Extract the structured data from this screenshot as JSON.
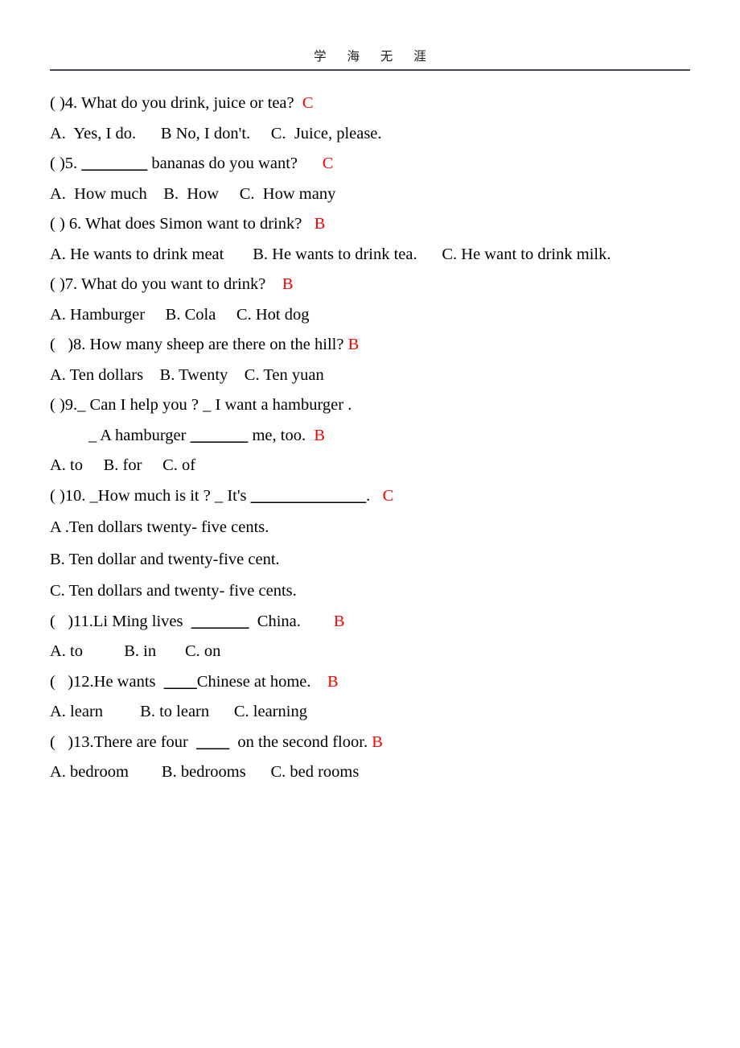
{
  "header": {
    "watermark_title": "学 海 无 涯"
  },
  "document": {
    "blocks": [
      {
        "type": "question",
        "number": "4",
        "prefix": "( )4. ",
        "text": "What do you drink, juice or tea?",
        "gap": "  ",
        "answer": "C"
      },
      {
        "type": "options",
        "text": "A.  Yes, I do.      B No, I don't.     C.  Juice, please."
      },
      {
        "type": "question_blank",
        "number": "5",
        "prefix": "( )5. ",
        "blank": "________",
        "text_after": " bananas do you want?",
        "gap": "      ",
        "answer": "C"
      },
      {
        "type": "options",
        "text": "A.  How much    B.  How     C.  How many"
      },
      {
        "type": "question",
        "number": "6",
        "prefix": "( ) 6. ",
        "text": "What does Simon want to drink?",
        "gap": "   ",
        "answer": "B"
      },
      {
        "type": "options",
        "text": "A. He wants to drink meat       B. He wants to drink tea.      C. He want to drink milk."
      },
      {
        "type": "question",
        "number": "7",
        "prefix": "( )7. ",
        "text": "What do you want to drink?",
        "gap": "    ",
        "answer": "B"
      },
      {
        "type": "options",
        "text": "A. Hamburger     B. Cola     C. Hot dog"
      },
      {
        "type": "question",
        "number": "8",
        "prefix": "(   )8. ",
        "text": "How many sheep are there on the hill?",
        "gap": " ",
        "answer": "B"
      },
      {
        "type": "options",
        "text": "A. Ten dollars    B. Twenty    C. Ten yuan"
      },
      {
        "type": "question",
        "number": "9",
        "prefix": "( )9.",
        "text": "_ Can I help you ? _ I want a hamburger .",
        "gap": "",
        "answer": ""
      },
      {
        "type": "continuation_blank",
        "text_before": "_ A hamburger ",
        "blank": "_______",
        "text_after": " me, too.",
        "gap": "  ",
        "answer": "B"
      },
      {
        "type": "options",
        "text": "A. to     B. for     C. of"
      },
      {
        "type": "question_blank",
        "number": "10",
        "prefix": "( )10. _How much is it ? _ It's ",
        "blank": "______________",
        "text_after": ".",
        "gap": "   ",
        "answer": "C"
      },
      {
        "type": "options_stacked",
        "text": "A .Ten dollars twenty- five cents."
      },
      {
        "type": "options_stacked",
        "text": "B. Ten dollar and twenty-five cent."
      },
      {
        "type": "options_stacked",
        "text": "C. Ten dollars and twenty- five cents."
      },
      {
        "type": "question_blank",
        "number": "11",
        "prefix": "(   )11.Li Ming lives  ",
        "blank": "_______",
        "text_after": "  China.",
        "gap": "        ",
        "answer": "B"
      },
      {
        "type": "options",
        "text": "A. to          B. in       C. on"
      },
      {
        "type": "question_blank",
        "number": "12",
        "prefix": "(   )12.He wants  ",
        "blank": "____",
        "text_after": "Chinese at home.",
        "gap": "    ",
        "answer": "B"
      },
      {
        "type": "options",
        "text": "A. learn         B. to learn      C. learning"
      },
      {
        "type": "question_blank",
        "number": "13",
        "prefix": "(   )13.There are four  ",
        "blank": "____",
        "text_after": "  on the second floor.",
        "gap": " ",
        "answer": "B"
      },
      {
        "type": "options",
        "text": "A. bedroom        B. bedrooms      C. bed rooms"
      }
    ]
  },
  "colors": {
    "answer_red": "#ff0000",
    "rule": "#4a4453",
    "text": "#000000"
  }
}
